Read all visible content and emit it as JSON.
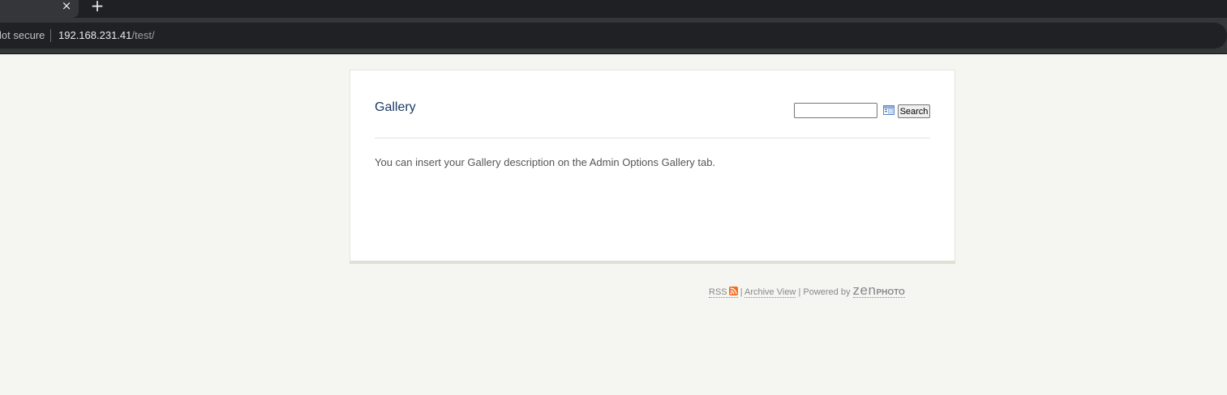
{
  "browser": {
    "tab_close_symbol": "×",
    "new_tab_symbol": "+",
    "security_label": "lot secure",
    "url_host": "192.168.231.41",
    "url_path": "/test/"
  },
  "gallery": {
    "title": "Gallery",
    "search_button_label": "Search",
    "search_value": "",
    "description": "You can insert your Gallery description on the Admin Options Gallery tab."
  },
  "footer": {
    "rss_label": "RSS",
    "separator": "|",
    "archive_label": "Archive View",
    "powered_by": "Powered by",
    "logo_big": "zen",
    "logo_small": "PHOTO"
  },
  "colors": {
    "title": "#1b3a63",
    "rss_orange": "#f26d21",
    "page_bg": "#f5f5f2"
  },
  "icons": {
    "tab_close": "close-icon",
    "new_tab": "plus-icon",
    "search_options": "search-options-icon",
    "rss": "rss-icon"
  }
}
